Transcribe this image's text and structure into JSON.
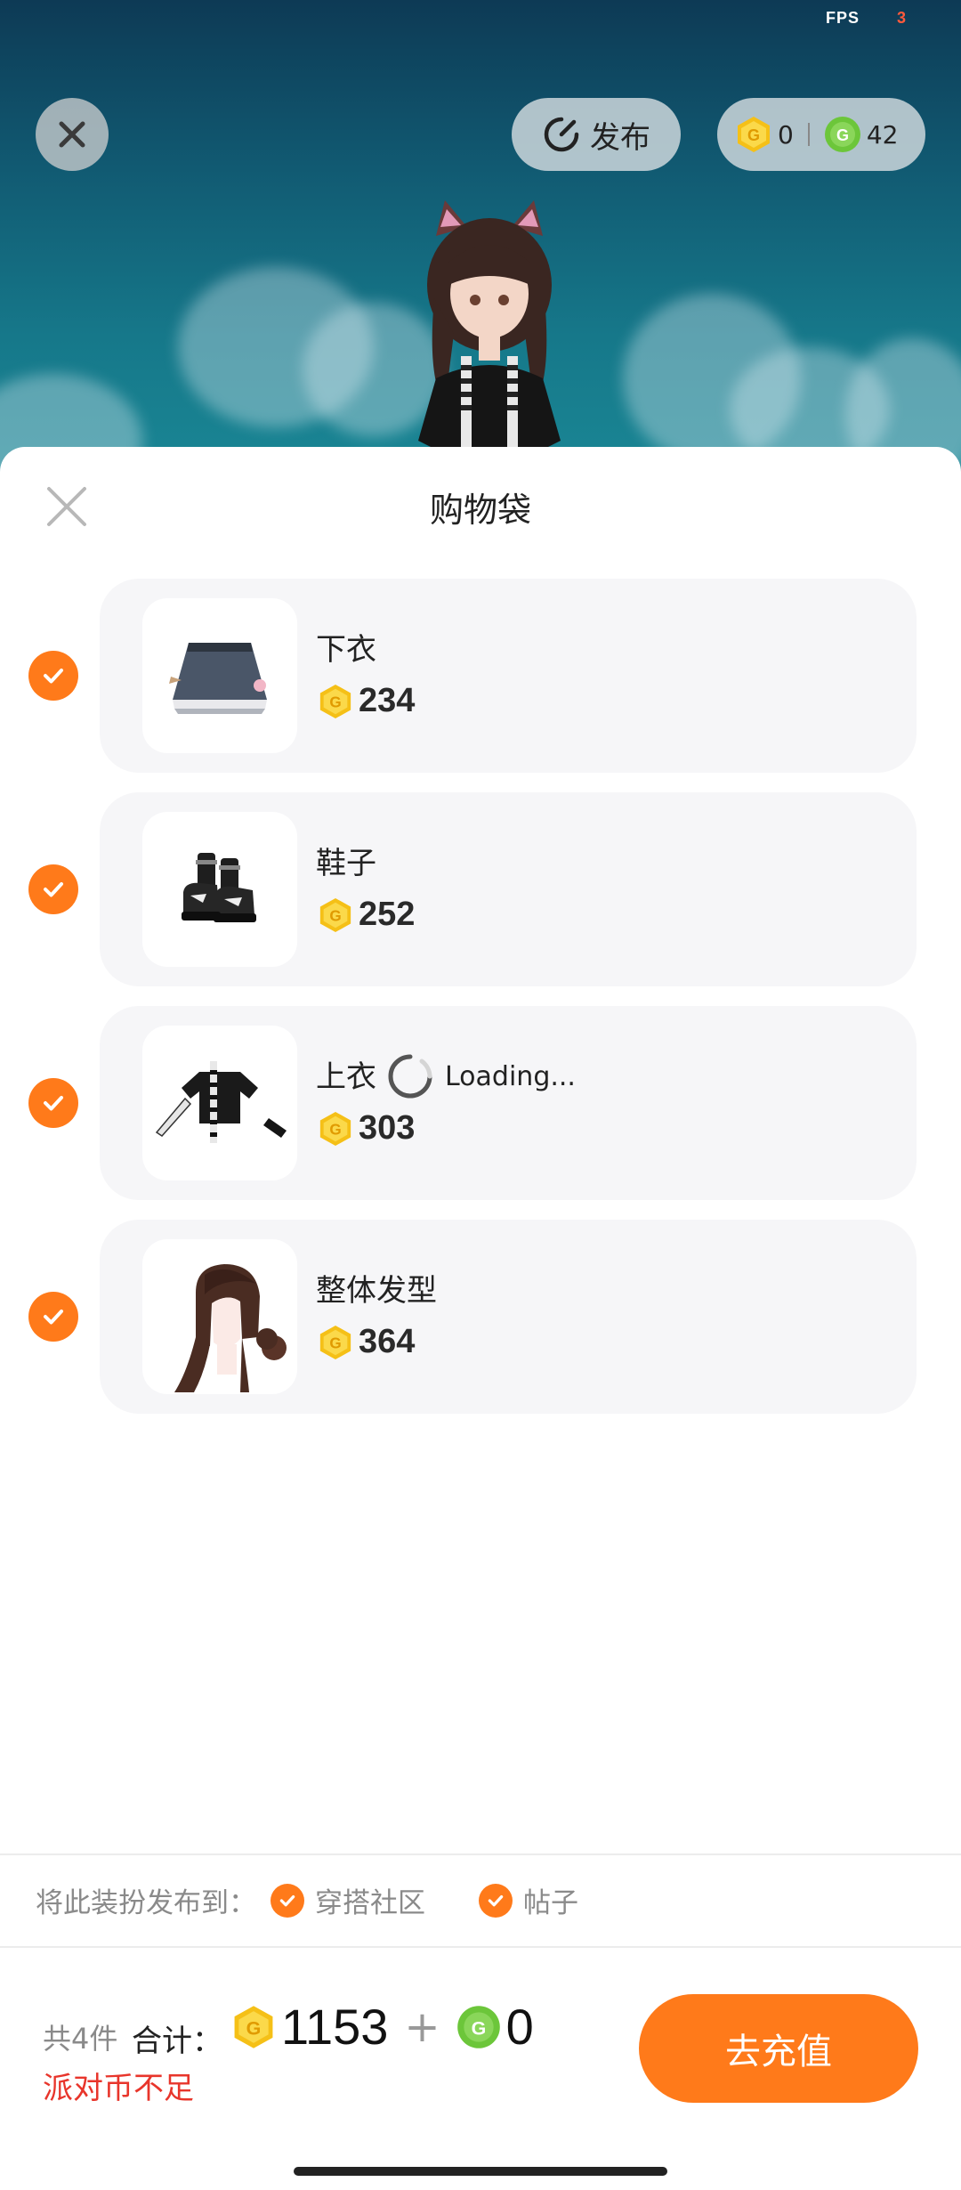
{
  "status": {
    "fps_label": "FPS",
    "fps_value": "3"
  },
  "top_bar": {
    "publish_label": "发布",
    "gold_coins": "0",
    "green_coins": "42"
  },
  "sheet": {
    "title": "购物袋",
    "items": [
      {
        "name": "下衣",
        "price": "234",
        "checked": true,
        "thumb": "skirt-icon"
      },
      {
        "name": "鞋子",
        "price": "252",
        "checked": true,
        "thumb": "shoes-icon"
      },
      {
        "name": "上衣",
        "price": "303",
        "checked": true,
        "thumb": "top-icon",
        "loading_text": "Loading..."
      },
      {
        "name": "整体发型",
        "price": "364",
        "checked": true,
        "thumb": "hair-icon"
      }
    ],
    "publish_to": {
      "label": "将此装扮发布到：",
      "options": [
        "穿搭社区",
        "帖子"
      ]
    }
  },
  "footer": {
    "count_text": "共4件",
    "total_label": "合计：",
    "gold_total": "1153",
    "plus": "+",
    "green_total": "0",
    "warning": "派对币不足",
    "recharge_label": "去充值"
  },
  "colors": {
    "accent": "#ff7a1a",
    "warning": "#e8352b",
    "gold": "#f5c017",
    "green": "#6cc63a"
  }
}
